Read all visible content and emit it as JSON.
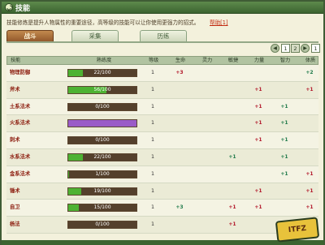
{
  "window": {
    "title": "技能",
    "title_icon": "swirl-icon"
  },
  "intro": "技能修炼是提升人物属性的重要途径，高等级的技能可以让你使用更强力的招式。",
  "help_link": "帮助[1]",
  "tabs": [
    {
      "label": "战斗",
      "active": true
    },
    {
      "label": "采集",
      "active": false
    },
    {
      "label": "历练",
      "active": false
    }
  ],
  "pager": {
    "prev_icon": "prev-icon",
    "pages": [
      "1",
      "2"
    ],
    "current": "1",
    "next_icon": "next-icon",
    "last": "1"
  },
  "columns": [
    "技能",
    "熟练度",
    "等级",
    "生命",
    "灵力",
    "敏捷",
    "力量",
    "智力",
    "体质"
  ],
  "rows": [
    {
      "name": "物理防御",
      "prof": "22/100",
      "pct": 0.22,
      "level": "1",
      "life": "+3",
      "mana": "",
      "agi": "",
      "str": "",
      "int": "",
      "sta": "+2",
      "sta_color": "green",
      "life_color": "red"
    },
    {
      "name": "斧术",
      "prof": "56/100",
      "pct": 0.56,
      "level": "1",
      "life": "",
      "mana": "",
      "agi": "",
      "str": "+1",
      "int": "",
      "sta": "+1",
      "str_color": "red",
      "sta_color": "red"
    },
    {
      "name": "土系法术",
      "prof": "0/100",
      "pct": 0.0,
      "level": "1",
      "life": "",
      "mana": "",
      "agi": "",
      "str": "+1",
      "int": "+1",
      "sta": "",
      "str_color": "red",
      "int_color": "green"
    },
    {
      "name": "火系法术",
      "prof": "",
      "pct": 1.0,
      "level": "1",
      "life": "",
      "mana": "",
      "agi": "",
      "str": "+1",
      "int": "+1",
      "sta": "",
      "str_color": "red",
      "int_color": "green",
      "purple": true
    },
    {
      "name": "刺术",
      "prof": "0/100",
      "pct": 0.0,
      "level": "1",
      "life": "",
      "mana": "",
      "agi": "",
      "str": "+1",
      "int": "+1",
      "sta": "",
      "str_color": "red",
      "int_color": "green"
    },
    {
      "name": "水系法术",
      "prof": "22/100",
      "pct": 0.22,
      "level": "1",
      "life": "",
      "mana": "",
      "agi": "+1",
      "str": "",
      "int": "+1",
      "sta": "",
      "agi_color": "green",
      "int_color": "green"
    },
    {
      "name": "金系法术",
      "prof": "1/100",
      "pct": 0.01,
      "level": "1",
      "life": "",
      "mana": "",
      "agi": "",
      "str": "",
      "int": "+1",
      "sta": "+1",
      "int_color": "green",
      "sta_color": "red"
    },
    {
      "name": "锤术",
      "prof": "19/100",
      "pct": 0.19,
      "level": "1",
      "life": "",
      "mana": "",
      "agi": "",
      "str": "+1",
      "int": "",
      "sta": "+1",
      "str_color": "red",
      "sta_color": "red"
    },
    {
      "name": "自卫",
      "prof": "15/100",
      "pct": 0.15,
      "level": "1",
      "life": "+3",
      "mana": "",
      "agi": "+1",
      "str": "+1",
      "int": "",
      "sta": "+1",
      "life_color": "green",
      "agi_color": "red",
      "str_color": "red",
      "sta_color": "red"
    },
    {
      "name": "杨法",
      "prof": "0/100",
      "pct": 0.0,
      "level": "1",
      "life": "",
      "mana": "",
      "agi": "+1",
      "str": "",
      "int": "+1",
      "sta": "",
      "agi_color": "red",
      "int_color": "green"
    }
  ],
  "colors": {
    "frame": "#3f5c35",
    "tab_active": "#a86a38",
    "bar_fill": "#4db233",
    "bar_purple": "#9a5cc8"
  },
  "watermark": "ITFZ"
}
